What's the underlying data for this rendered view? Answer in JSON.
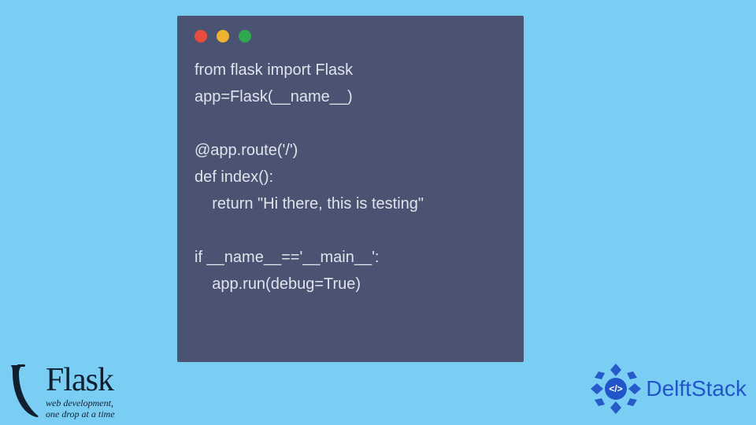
{
  "code": {
    "lines": [
      "from flask import Flask",
      "app=Flask(__name__)",
      "",
      "@app.route('/')",
      "def index():",
      "    return \"Hi there, this is testing\"",
      "",
      "if __name__=='__main__':",
      "    app.run(debug=True)"
    ]
  },
  "window": {
    "traffic_colors": {
      "red": "#e94b3c",
      "yellow": "#f1b131",
      "green": "#2fa84f"
    },
    "bg": "#4a5472",
    "fg": "#e0e3ec"
  },
  "page_bg": "#7acef4",
  "flask": {
    "title": "Flask",
    "subtitle_line1": "web development,",
    "subtitle_line2": "one drop at a time"
  },
  "delft": {
    "name": "DelftStack",
    "badge_symbol": "</>",
    "badge_color": "#2256c8"
  }
}
